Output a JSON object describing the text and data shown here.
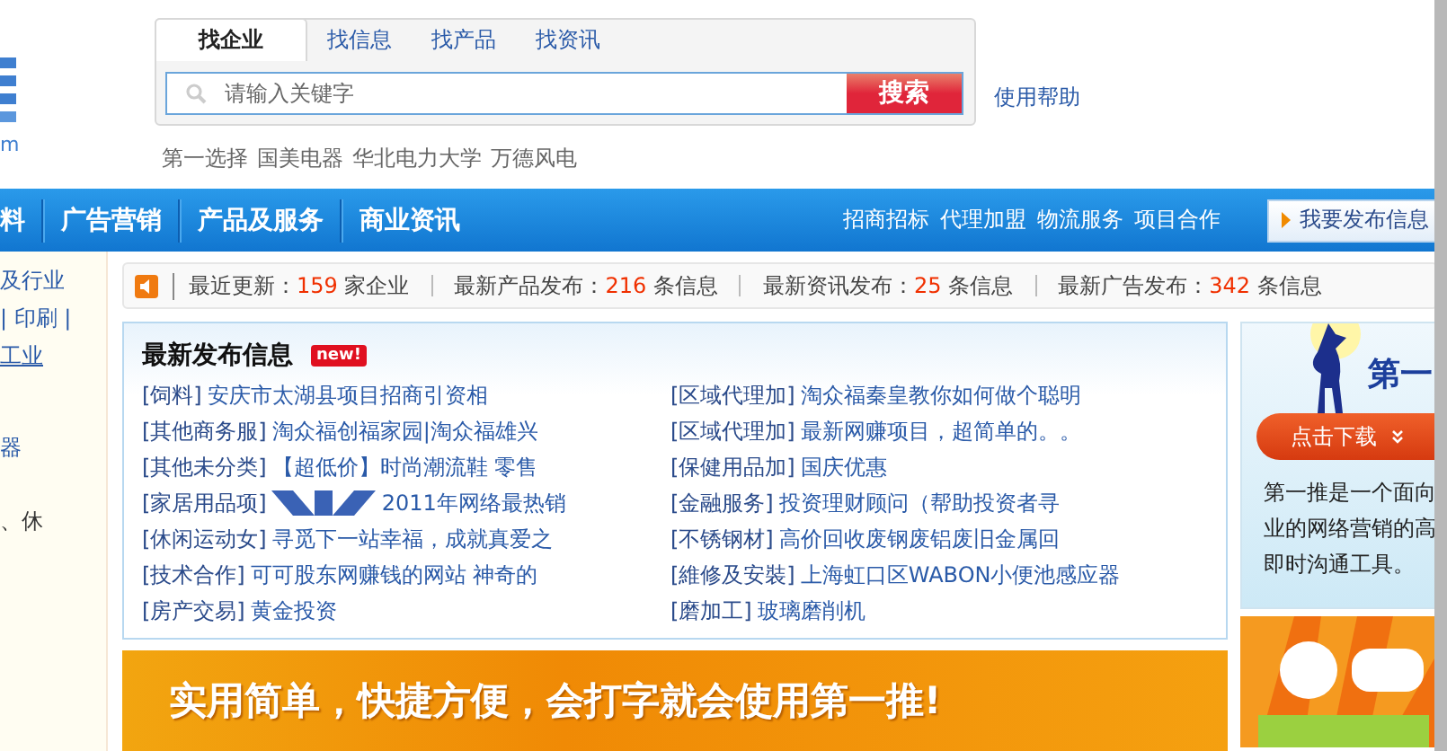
{
  "logo": {
    "text": "m"
  },
  "search": {
    "tabs": [
      {
        "label": "找企业",
        "selected": true
      },
      {
        "label": "找信息",
        "selected": false
      },
      {
        "label": "找产品",
        "selected": false
      },
      {
        "label": "找资讯",
        "selected": false
      }
    ],
    "placeholder": "请输入关键字",
    "button": "搜索",
    "help": "使用帮助"
  },
  "hot_words": [
    "第一选择",
    "国美电器",
    "华北电力大学",
    "万德风电"
  ],
  "nav": {
    "left": [
      "料",
      "广告营销",
      "产品及服务",
      "商业资讯"
    ],
    "right": [
      "招商招标",
      "代理加盟",
      "物流服务",
      "项目合作"
    ],
    "publish_button": "我要发布信息"
  },
  "sidebar": {
    "items": [
      {
        "text": "及行业",
        "kind": "text"
      },
      {
        "text": "| 印刷 |",
        "kind": "text"
      },
      {
        "text": "工业",
        "kind": "link"
      },
      {
        "text": "器",
        "kind": "text"
      },
      {
        "text": "、休",
        "kind": "text"
      }
    ]
  },
  "stats": [
    {
      "label": "最近更新：",
      "count": "159",
      "unit": "家企业"
    },
    {
      "label": "最新产品发布：",
      "count": "216",
      "unit": "条信息"
    },
    {
      "label": "最新资讯发布：",
      "count": "25",
      "unit": "条信息"
    },
    {
      "label": "最新广告发布：",
      "count": "342",
      "unit": "条信息"
    }
  ],
  "latest": {
    "title": "最新发布信息",
    "badge": "new!",
    "items": [
      {
        "category": "[饲料]",
        "text": "安庆市太湖县项目招商引资相"
      },
      {
        "category": "[区域代理加]",
        "text": "淘众福秦皇教你如何做个聪明"
      },
      {
        "category": "[其他商务服]",
        "text": "淘众福创福家园|淘众福雄兴"
      },
      {
        "category": "[区域代理加]",
        "text": "最新网赚项目，超简单的。。"
      },
      {
        "category": "[其他未分类]",
        "text": "【超低价】时尚潮流鞋 零售"
      },
      {
        "category": "[保健用品加]",
        "text": "国庆优惠"
      },
      {
        "category": "[家居用品项]",
        "text": "2011年网络最热销",
        "logo": true
      },
      {
        "category": "[金融服务]",
        "text": "投资理财顾问（帮助投资者寻"
      },
      {
        "category": "[休闲运动女]",
        "text": "寻觅下一站幸福，成就真爱之"
      },
      {
        "category": "[不锈钢材]",
        "text": "高价回收废钢废铝废旧金属回"
      },
      {
        "category": "[技术合作]",
        "text": "可可股东网赚钱的网站 神奇的"
      },
      {
        "category": "[維修及安裝]",
        "text": "上海虹口区WABON小便池感应器"
      },
      {
        "category": "[房产交易]",
        "text": "黄金投资"
      },
      {
        "category": "[磨加工]",
        "text": "玻璃磨削机"
      }
    ]
  },
  "banner": {
    "text": "实用简单，快捷方便，会打字就会使用第一推!"
  },
  "side_ad": {
    "title": "第一",
    "button": "点击下载",
    "lines": [
      "第一推是一个面向",
      "业的网络营销的高",
      "即时沟通工具。"
    ]
  },
  "promo_ad": {
    "kind": "picture"
  }
}
